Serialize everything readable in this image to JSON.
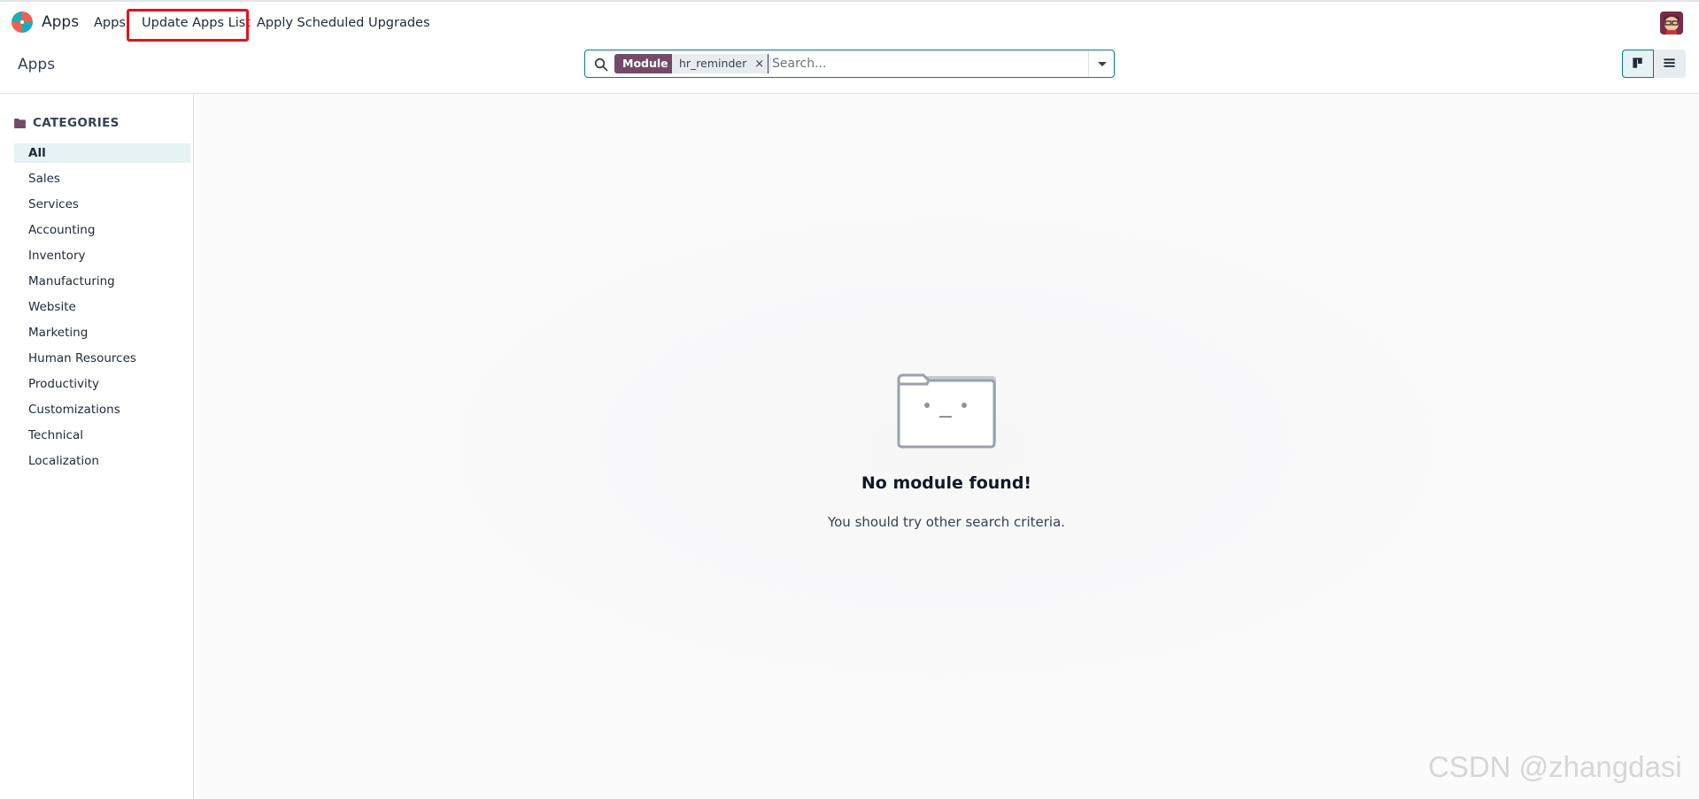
{
  "topbar": {
    "brand": "Apps",
    "menu": [
      {
        "label": "Apps"
      },
      {
        "label": "Update Apps List"
      },
      {
        "label": "Apply Scheduled Upgrades"
      }
    ]
  },
  "control": {
    "title": "Apps",
    "search": {
      "facet_label": "Module",
      "facet_value": "hr_reminder",
      "facet_remove": "×",
      "placeholder": "Search..."
    }
  },
  "sidebar": {
    "header": "CATEGORIES",
    "items": [
      {
        "label": "All",
        "active": true
      },
      {
        "label": "Sales"
      },
      {
        "label": "Services"
      },
      {
        "label": "Accounting"
      },
      {
        "label": "Inventory"
      },
      {
        "label": "Manufacturing"
      },
      {
        "label": "Website"
      },
      {
        "label": "Marketing"
      },
      {
        "label": "Human Resources"
      },
      {
        "label": "Productivity"
      },
      {
        "label": "Customizations"
      },
      {
        "label": "Technical"
      },
      {
        "label": "Localization"
      }
    ]
  },
  "empty": {
    "title": "No module found!",
    "subtitle": "You should try other search criteria."
  },
  "watermark": "CSDN @zhangdasi",
  "colors": {
    "accent": "#714b67",
    "teal": "#017e84",
    "highlight": "#e8101a"
  },
  "icons": {
    "logo": "odoo-apps-logo",
    "search": "search-icon",
    "caret": "caret-down-icon",
    "kanban": "kanban-view-icon",
    "list": "list-view-icon",
    "folder": "folder-icon",
    "empty": "empty-folder-face-illustration"
  }
}
